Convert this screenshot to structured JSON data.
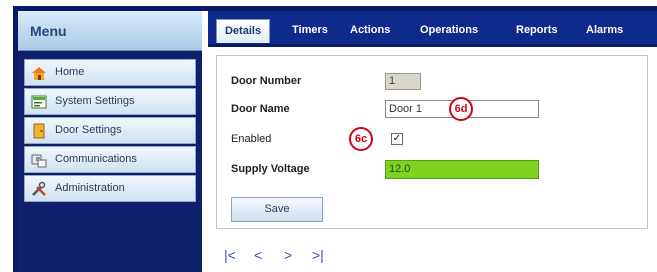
{
  "sidebar": {
    "title": "Menu",
    "items": [
      {
        "label": "Home",
        "icon": "home-icon"
      },
      {
        "label": "System Settings",
        "icon": "system-settings-icon"
      },
      {
        "label": "Door Settings",
        "icon": "door-icon"
      },
      {
        "label": "Communications",
        "icon": "communications-icon"
      },
      {
        "label": "Administration",
        "icon": "administration-icon"
      }
    ]
  },
  "tabs": [
    {
      "label": "Details",
      "active": true
    },
    {
      "label": "Timers"
    },
    {
      "label": "Actions"
    },
    {
      "label": "Operations"
    },
    {
      "label": "Reports"
    },
    {
      "label": "Alarms"
    }
  ],
  "form": {
    "door_number_label": "Door Number",
    "door_number_value": "1",
    "door_name_label": "Door Name",
    "door_name_value": "Door 1",
    "enabled_label": "Enabled",
    "enabled_checked": true,
    "supply_voltage_label": "Supply Voltage",
    "supply_voltage_value": "12.0",
    "save_label": "Save"
  },
  "callouts": {
    "name": "6d",
    "enabled": "6c"
  },
  "pager": {
    "first": "|<",
    "prev": "<",
    "next": ">",
    "last": ">|"
  },
  "colors": {
    "nav_dark": "#0e1f6b",
    "tab_bar": "#0e2a8a",
    "voltage_ok": "#7ed321",
    "callout_red": "#d0021b"
  }
}
